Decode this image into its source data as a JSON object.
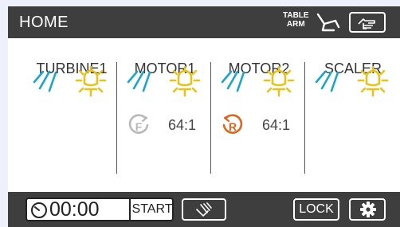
{
  "header": {
    "title": "HOME",
    "table_arm_line1": "TABLE",
    "table_arm_line2": "ARM",
    "chair_icon": "dental-chair-icon",
    "hand_icon": "hand-pointer-icon"
  },
  "instruments": [
    {
      "name": "TURBINE1",
      "spray_color": "#1aa6c9",
      "light_color": "#e8c21b"
    },
    {
      "name": "MOTOR1",
      "spray_color": "#1aa6c9",
      "light_color": "#e8c21b",
      "direction": "F",
      "direction_color": "#b8b8b8",
      "ratio": "64:1"
    },
    {
      "name": "MOTOR2",
      "spray_color": "#1aa6c9",
      "light_color": "#e8c21b",
      "direction": "R",
      "direction_color": "#e0641c",
      "ratio": "64:1"
    },
    {
      "name": "SCALER",
      "spray_color": "#1aa6c9",
      "light_color": "#e8c21b"
    }
  ],
  "bottom": {
    "timer": "00:00",
    "start_label": "START",
    "lock_label": "LOCK",
    "wash_icon": "cup-rinse-icon",
    "gear_icon": "gear-icon"
  }
}
